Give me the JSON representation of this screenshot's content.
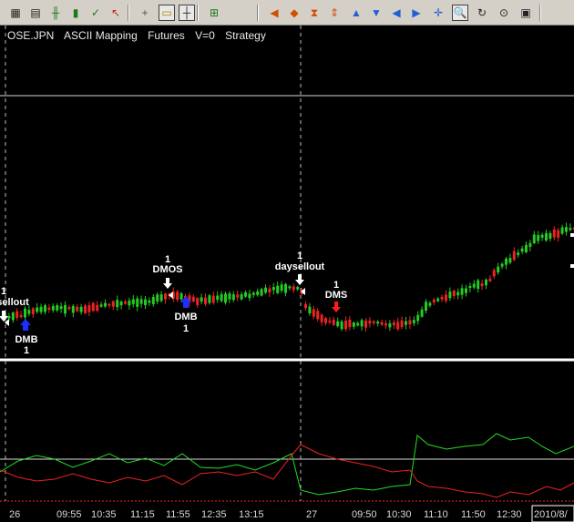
{
  "toolbar": {
    "buttons": [
      {
        "name": "bar-chart-icon",
        "glyph": "▦",
        "color": "#222"
      },
      {
        "name": "data-window-icon",
        "glyph": "▤",
        "color": "#222"
      },
      {
        "name": "ohlc-bar-icon",
        "glyph": "╫",
        "color": "#1a7a1a"
      },
      {
        "name": "candlestick-icon",
        "glyph": "▮",
        "color": "#1a7a1a"
      },
      {
        "name": "line-chart-icon",
        "glyph": "✓",
        "color": "#1a7a1a"
      },
      {
        "name": "arrow-pointer-icon",
        "glyph": "↖",
        "color": "#c0202a"
      },
      {
        "name": "crosshair-icon",
        "glyph": "+",
        "color": "#555"
      },
      {
        "name": "comment-icon",
        "glyph": "▭",
        "color": "#b08000",
        "active": true
      },
      {
        "name": "crosshair-tool-icon",
        "glyph": "┼",
        "color": "#222",
        "active": true
      },
      {
        "name": "add-indicator-icon",
        "glyph": "⊞",
        "color": "#1a7a1a"
      },
      {
        "name": "scroll-left-end-icon",
        "glyph": "◀",
        "color": "#d05000"
      },
      {
        "name": "scroll-both-icon",
        "glyph": "◆",
        "color": "#d05000"
      },
      {
        "name": "hourglass-icon",
        "glyph": "⧗",
        "color": "#d05000"
      },
      {
        "name": "expand-icon",
        "glyph": "⇕",
        "color": "#d05000"
      },
      {
        "name": "zoom-up-icon",
        "glyph": "▲",
        "color": "#2060d0"
      },
      {
        "name": "zoom-down-icon",
        "glyph": "▼",
        "color": "#2060d0"
      },
      {
        "name": "scroll-left-icon",
        "glyph": "◀",
        "color": "#2060d0"
      },
      {
        "name": "scroll-right-icon",
        "glyph": "▶",
        "color": "#2060d0"
      },
      {
        "name": "fit-icon",
        "glyph": "✛",
        "color": "#2060d0"
      },
      {
        "name": "zoom-icon",
        "glyph": "🔍",
        "color": "#2060d0",
        "active": true
      },
      {
        "name": "refresh-icon",
        "glyph": "↻",
        "color": "#222"
      },
      {
        "name": "pin-icon",
        "glyph": "⊙",
        "color": "#222"
      },
      {
        "name": "save-icon",
        "glyph": "▣",
        "color": "#222"
      }
    ]
  },
  "title": {
    "symbol": "OSE.JPN",
    "mapping": "ASCII Mapping",
    "category": "Futures",
    "volume": "V=0",
    "strategy": "Strategy"
  },
  "axis": {
    "time_labels": [
      "26",
      "09:55",
      "10:35",
      "11:15",
      "11:55",
      "12:35",
      "13:15",
      "27",
      "09:50",
      "10:30",
      "11:10",
      "11:50",
      "12:30",
      "2010/8/"
    ]
  },
  "signals": [
    {
      "id": "sig1",
      "qty": "1",
      "text": "sellout",
      "kind": "exit"
    },
    {
      "id": "sig2",
      "qty": "1",
      "text": "DMB",
      "kind": "buy"
    },
    {
      "id": "sig3",
      "qty": "1",
      "text": "DMOS",
      "kind": "exit"
    },
    {
      "id": "sig4",
      "qty": "1",
      "text": "DMB",
      "kind": "buy"
    },
    {
      "id": "sig5",
      "qty": "1",
      "text": "daysellout",
      "kind": "exit"
    },
    {
      "id": "sig6",
      "qty": "1",
      "text": "DMS",
      "kind": "sell"
    }
  ],
  "colors": {
    "up": "#22cc22",
    "down": "#ee2222",
    "indicator_green": "#22dd22",
    "indicator_red": "#ee2222",
    "buy_arrow": "#1a30ff",
    "sell_arrow": "#ff1a1a",
    "exit_arrow": "#ffffff"
  },
  "chart_data": {
    "type": "candlestick",
    "categories": [
      "26",
      "09:55",
      "10:35",
      "11:15",
      "11:55",
      "12:35",
      "13:15",
      "27",
      "09:50",
      "10:30",
      "11:10",
      "11:50",
      "12:30",
      "2010/8/"
    ]
  }
}
